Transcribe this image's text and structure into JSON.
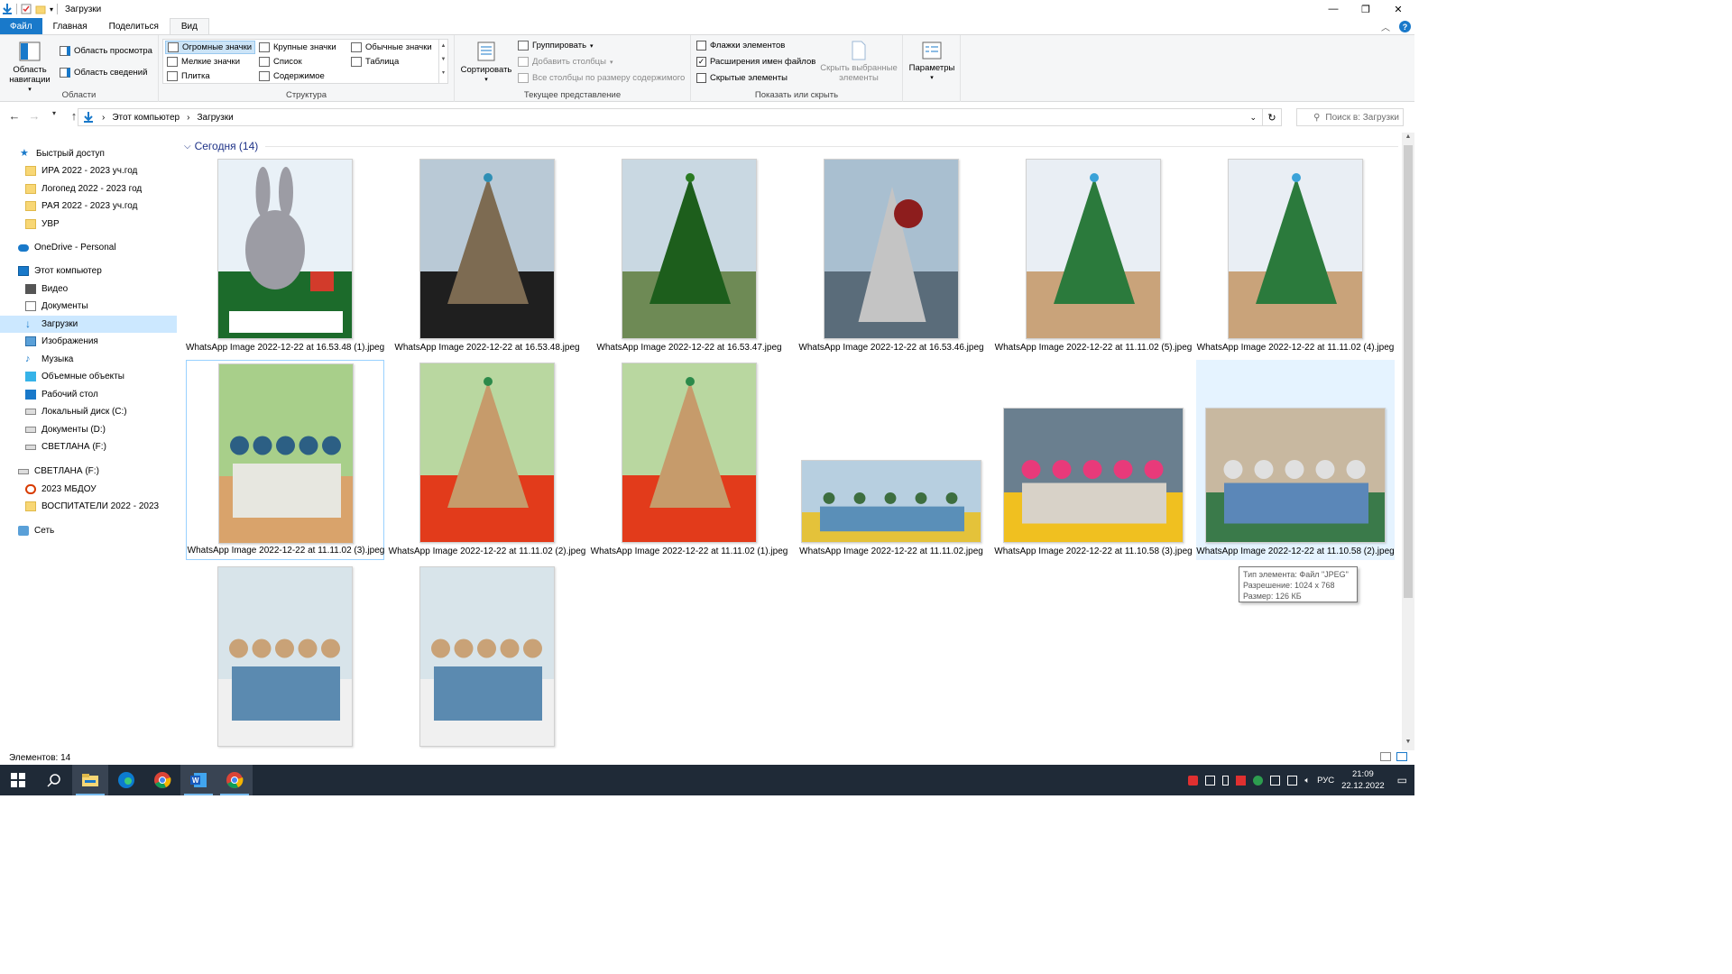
{
  "window": {
    "title": "Загрузки"
  },
  "ribbon_tabs": [
    "Файл",
    "Главная",
    "Поделиться",
    "Вид"
  ],
  "ribbon": {
    "panes": {
      "nav_pane": "Область навигации",
      "preview_pane": "Область просмотра",
      "details_pane": "Область сведений",
      "label": "Области"
    },
    "layout": {
      "items": [
        "Огромные значки",
        "Крупные значки",
        "Обычные значки",
        "Мелкие значки",
        "Список",
        "Таблица",
        "Плитка",
        "Содержимое"
      ],
      "selected": "Огромные значки",
      "label": "Структура"
    },
    "current_view": {
      "sort": "Сортировать",
      "group": "Группировать",
      "add_columns": "Добавить столбцы",
      "fit_columns": "Все столбцы по размеру содержимого",
      "label": "Текущее представление"
    },
    "show_hide": {
      "item_checkboxes": "Флажки элементов",
      "file_extensions": "Расширения имен файлов",
      "hidden_items": "Скрытые элементы",
      "hide_selected": "Скрыть выбранные элементы",
      "label": "Показать или скрыть"
    },
    "options": "Параметры"
  },
  "address": {
    "breadcrumbs": [
      "Этот компьютер",
      "Загрузки"
    ],
    "search_placeholder": "Поиск в: Загрузки"
  },
  "nav_pane": {
    "items": [
      {
        "label": "Быстрый доступ",
        "icon": "star-icon",
        "level": 0
      },
      {
        "label": "ИРА 2022 - 2023 уч.год",
        "icon": "folder-icon",
        "level": 1
      },
      {
        "label": "Логопед 2022 - 2023 год",
        "icon": "folder-icon",
        "level": 1
      },
      {
        "label": "РАЯ 2022 - 2023 уч.год",
        "icon": "folder-icon",
        "level": 1
      },
      {
        "label": "УВР",
        "icon": "folder-icon",
        "level": 1
      },
      {
        "label": "OneDrive - Personal",
        "icon": "cloud-icon",
        "level": 0
      },
      {
        "label": "Этот компьютер",
        "icon": "computer-icon",
        "level": 0
      },
      {
        "label": "Видео",
        "icon": "video-icon",
        "level": 1
      },
      {
        "label": "Документы",
        "icon": "documents-icon",
        "level": 1
      },
      {
        "label": "Загрузки",
        "icon": "downloads-icon",
        "level": 1
      },
      {
        "label": "Изображения",
        "icon": "pictures-icon",
        "level": 1
      },
      {
        "label": "Музыка",
        "icon": "music-icon",
        "level": 1
      },
      {
        "label": "Объемные объекты",
        "icon": "3d-objects-icon",
        "level": 1
      },
      {
        "label": "Рабочий стол",
        "icon": "desktop-icon",
        "level": 1
      },
      {
        "label": "Локальный диск (C:)",
        "icon": "drive-icon",
        "level": 1
      },
      {
        "label": "Документы (D:)",
        "icon": "drive-icon",
        "level": 1
      },
      {
        "label": "СВЕТЛАНА (F:)",
        "icon": "usb-drive-icon",
        "level": 1
      },
      {
        "label": "СВЕТЛАНА (F:)",
        "icon": "usb-drive-icon",
        "level": 0
      },
      {
        "label": "2023 МБДОУ",
        "icon": "folder-red-icon",
        "level": 1
      },
      {
        "label": "ВОСПИТАТЕЛИ 2022 - 2023",
        "icon": "folder-icon",
        "level": 1
      },
      {
        "label": "Сеть",
        "icon": "network-icon",
        "level": 0
      }
    ],
    "selected": "Загрузки"
  },
  "content": {
    "group_header": "Сегодня (14)",
    "files": [
      {
        "name": "WhatsApp Image 2022-12-22 at 16.53.48 (1).jpeg",
        "scene": "bunny"
      },
      {
        "name": "WhatsApp Image 2022-12-22 at 16.53.48.jpeg",
        "scene": "tree-small"
      },
      {
        "name": "WhatsApp Image 2022-12-22 at 16.53.47.jpeg",
        "scene": "tree-tinsel"
      },
      {
        "name": "WhatsApp Image 2022-12-22 at 16.53.46.jpeg",
        "scene": "snowman"
      },
      {
        "name": "WhatsApp Image 2022-12-22 at 11.11.02 (5).jpeg",
        "scene": "wall-tree"
      },
      {
        "name": "WhatsApp Image 2022-12-22 at 11.11.02 (4).jpeg",
        "scene": "wall-tree"
      },
      {
        "name": "WhatsApp Image 2022-12-22 at 11.11.02 (3).jpeg",
        "scene": "kids-group"
      },
      {
        "name": "WhatsApp Image 2022-12-22 at 11.11.02 (2).jpeg",
        "scene": "kid-table"
      },
      {
        "name": "WhatsApp Image 2022-12-22 at 11.11.02 (1).jpeg",
        "scene": "kid-table"
      },
      {
        "name": "WhatsApp Image 2022-12-22 at 11.11.02.jpeg",
        "scene": "kids-paint-wide"
      },
      {
        "name": "WhatsApp Image 2022-12-22 at 11.10.58 (3).jpeg",
        "scene": "window-crafts"
      },
      {
        "name": "WhatsApp Image 2022-12-22 at 11.10.58 (2).jpeg",
        "scene": "kids-craft-wide"
      },
      {
        "name": "",
        "scene": "class-table"
      },
      {
        "name": "",
        "scene": "class-table"
      }
    ]
  },
  "tooltip": {
    "type": "Тип элемента: Файл \"JPEG\"",
    "resolution": "Разрешение: 1024 x 768",
    "size": "Размер: 126 КБ"
  },
  "status": {
    "count": "Элементов: 14"
  },
  "taskbar": {
    "apps": [
      "start-icon",
      "search-icon",
      "file-explorer-icon",
      "edge-icon",
      "chrome-icon",
      "word-icon",
      "chrome-icon"
    ],
    "lang": "РУС",
    "time": "21:09",
    "date": "22.12.2022"
  },
  "colors": {
    "accent": "#1979ca",
    "selection": "#cce8ff",
    "taskbar": "#1f2a37"
  }
}
